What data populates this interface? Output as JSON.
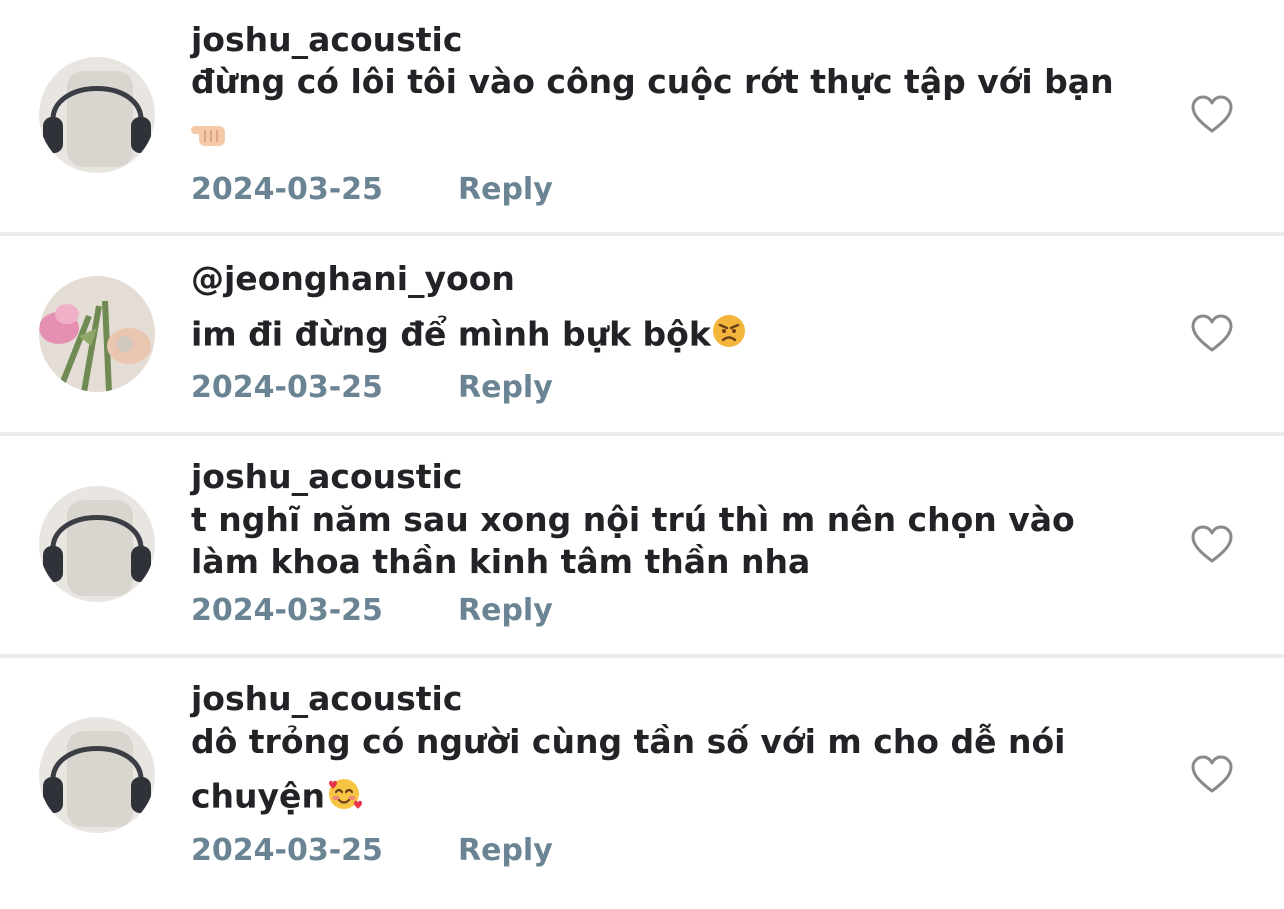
{
  "comments": [
    {
      "username": "joshu_acoustic",
      "text_lines": [
        "đừng có lôi tôi vào công cuộc rớt thực tập với bạn"
      ],
      "emoji": "backhand-index-pointing-left",
      "date": "2024-03-25",
      "reply_label": "Reply",
      "avatar": "headphones-avatar"
    },
    {
      "username": "@jeonghani_yoon",
      "text_lines": [
        "im đi đừng để mình bựk bộk"
      ],
      "emoji": "angry-face",
      "date": "2024-03-25",
      "reply_label": "Reply",
      "avatar": "flowers-avatar"
    },
    {
      "username": "joshu_acoustic",
      "text_lines": [
        "t nghĩ năm sau xong nội trú thì m nên chọn vào",
        "làm khoa thần kinh tâm thần nha"
      ],
      "date": "2024-03-25",
      "reply_label": "Reply",
      "avatar": "headphones-avatar"
    },
    {
      "username": "joshu_acoustic",
      "text_lines": [
        "dô trỏng có người cùng tần số với m cho dễ nói",
        "chuyện"
      ],
      "emoji": "smiling-face-with-hearts",
      "date": "2024-03-25",
      "reply_label": "Reply",
      "avatar": "headphones-avatar"
    }
  ],
  "colors": {
    "text": "#222326",
    "meta": "#6a8493",
    "heart_outline": "#8a8a8e",
    "divider": "#ececee"
  }
}
